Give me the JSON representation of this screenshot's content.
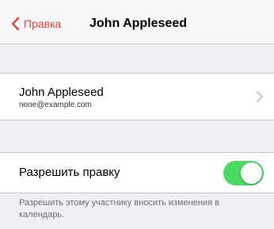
{
  "nav": {
    "back_label": "Правка",
    "title": "John Appleseed"
  },
  "contact": {
    "name": "John Appleseed",
    "email": "none@example.com"
  },
  "permission": {
    "label": "Разрешить правку",
    "enabled": true,
    "footer": "Разрешить этому участнику вносить изменения в календарь."
  },
  "colors": {
    "accent": "#e0433a",
    "switch_on": "#4cd964"
  }
}
